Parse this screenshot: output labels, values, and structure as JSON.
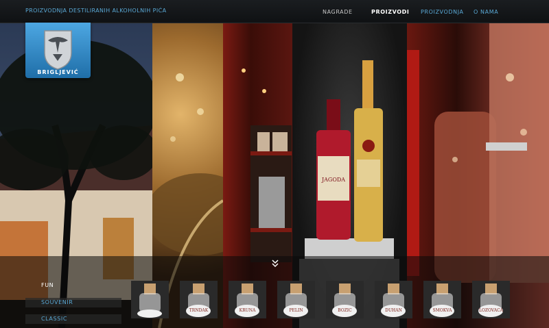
{
  "header": {
    "tagline": "PROIZVODNJA DESTILIRANIH ALKOHOLNIH PIćA",
    "nav": [
      {
        "label": "NAGRADE",
        "active": false,
        "color": "#c8c8c8"
      },
      {
        "label": "PROIZVODI",
        "active": true,
        "color": "#ffffff"
      },
      {
        "label": "PROIZVODNJA",
        "active": false,
        "color": "#5aa9d6"
      },
      {
        "label": "O NAMA",
        "active": false,
        "color": "#5aa9d6"
      }
    ]
  },
  "logo": {
    "label": "BRIGLJEVIĆ"
  },
  "bottles": {
    "left_label": "JAGODA"
  },
  "categories": [
    {
      "label": "FUN",
      "active": true,
      "color": "#ffffff"
    },
    {
      "label": "SOUVENIR",
      "active": false,
      "color": "#5aa9d6"
    },
    {
      "label": "CLASSIC",
      "active": false,
      "color": "#5aa9d6"
    }
  ],
  "products": [
    {
      "label": ""
    },
    {
      "label": "TRNDAK"
    },
    {
      "label": "KRUNA"
    },
    {
      "label": "PELIN"
    },
    {
      "label": "BOZIC"
    },
    {
      "label": "DUHAN"
    },
    {
      "label": "SMOKVA"
    },
    {
      "label": "LOZOVACA"
    }
  ],
  "colors": {
    "accent": "#5aa9d6",
    "logo_blue": "#2f86c4"
  }
}
